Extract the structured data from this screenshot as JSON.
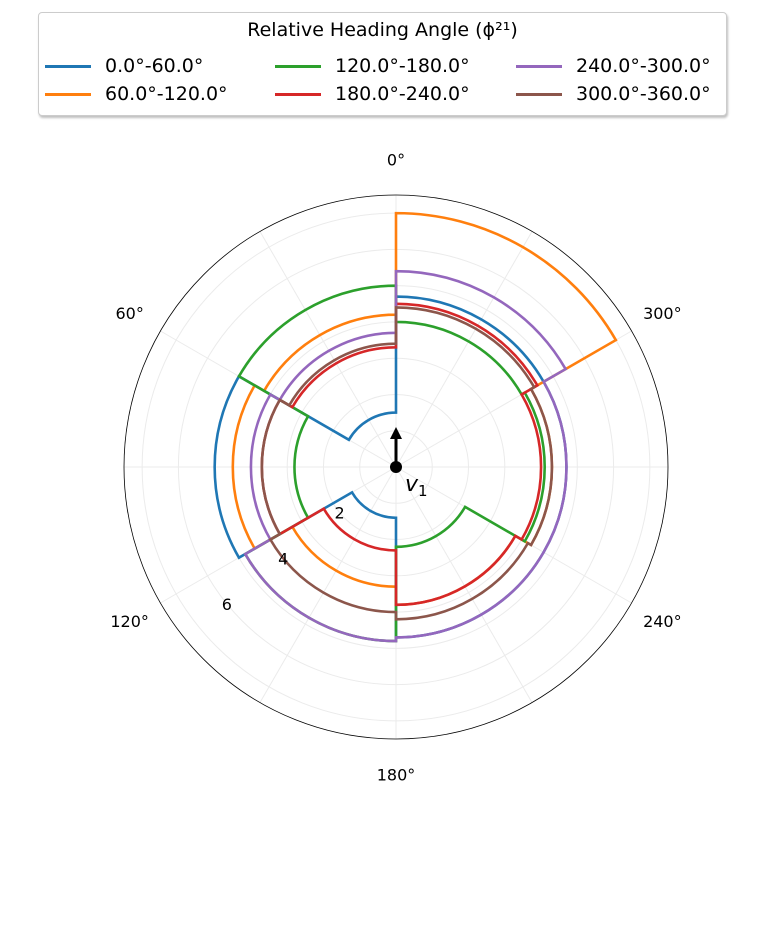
{
  "chart_data": {
    "type": "polar-step",
    "legend": {
      "title": "Relative Heading Angle (ϕ²¹)",
      "placement": "top"
    },
    "theta_zero": "top",
    "theta_direction": "counterclockwise",
    "theta_ticks": [
      "0°",
      "60°",
      "120°",
      "180°",
      "240°",
      "300°"
    ],
    "r_ticks": [
      "2",
      "4",
      "6"
    ],
    "r_max": 7.5,
    "grid": true,
    "annotation": "v1",
    "bin_edges_deg": [
      0,
      60,
      120,
      180,
      240,
      300,
      360
    ],
    "series": [
      {
        "name": "0.0°-60.0°",
        "color": "#1f77b4",
        "radii": [
          1.5,
          5.0,
          1.4,
          4.7,
          4.7,
          4.7
        ]
      },
      {
        "name": "60.0°-120.0°",
        "color": "#ff7f0e",
        "radii": [
          4.2,
          4.5,
          3.3,
          3.8,
          4.3,
          7.0
        ]
      },
      {
        "name": "120.0°-180.0°",
        "color": "#2ca02c",
        "radii": [
          5.0,
          2.8,
          4.8,
          2.2,
          4.1,
          4.0
        ]
      },
      {
        "name": "180.0°-240.0°",
        "color": "#d62728",
        "radii": [
          3.3,
          3.7,
          2.3,
          3.8,
          4.0,
          4.5
        ]
      },
      {
        "name": "240.0°-300.0°",
        "color": "#9467bd",
        "radii": [
          3.7,
          4.0,
          4.8,
          4.7,
          4.7,
          5.4
        ]
      },
      {
        "name": "300.0°-360.0°",
        "color": "#8c564b",
        "radii": [
          3.4,
          3.7,
          4.0,
          4.2,
          4.3,
          4.4
        ]
      }
    ]
  }
}
